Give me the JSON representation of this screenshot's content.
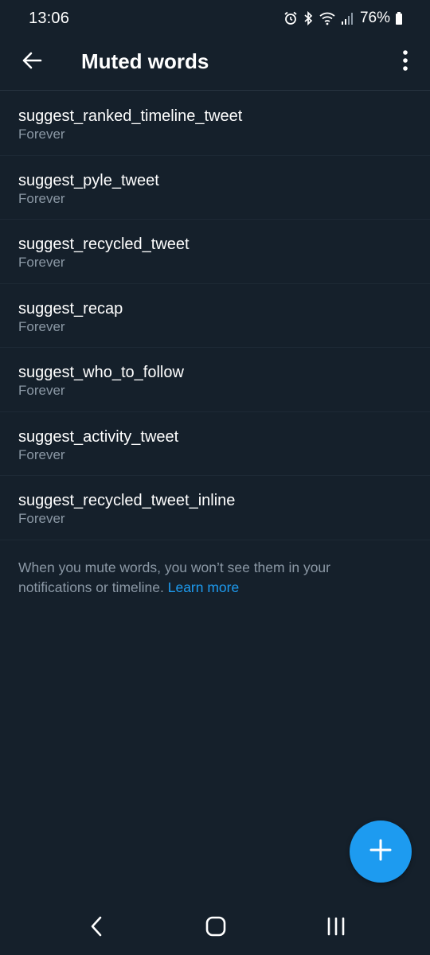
{
  "status_bar": {
    "time": "13:06",
    "battery": "76%",
    "icons": [
      "alarm-icon",
      "bluetooth-icon",
      "wifi-icon",
      "signal-icon",
      "battery-icon"
    ]
  },
  "header": {
    "title": "Muted words",
    "back_icon": "arrow-left-icon",
    "more_icon": "more-vertical-icon"
  },
  "muted_words": [
    {
      "word": "suggest_ranked_timeline_tweet",
      "duration": "Forever"
    },
    {
      "word": "suggest_pyle_tweet",
      "duration": "Forever"
    },
    {
      "word": "suggest_recycled_tweet",
      "duration": "Forever"
    },
    {
      "word": "suggest_recap",
      "duration": "Forever"
    },
    {
      "word": "suggest_who_to_follow",
      "duration": "Forever"
    },
    {
      "word": "suggest_activity_tweet",
      "duration": "Forever"
    },
    {
      "word": "suggest_recycled_tweet_inline",
      "duration": "Forever"
    }
  ],
  "info": {
    "text": "When you mute words, you won’t see them in your notifications or timeline. ",
    "link_text": "Learn more"
  },
  "fab": {
    "icon": "plus-icon"
  },
  "nav": {
    "back_icon": "nav-back-icon",
    "home_icon": "nav-home-icon",
    "recents_icon": "nav-recents-icon"
  },
  "colors": {
    "background": "#15202b",
    "accent": "#1d9bf0",
    "secondary_text": "#8b98a5",
    "divider": "#1d2935"
  }
}
